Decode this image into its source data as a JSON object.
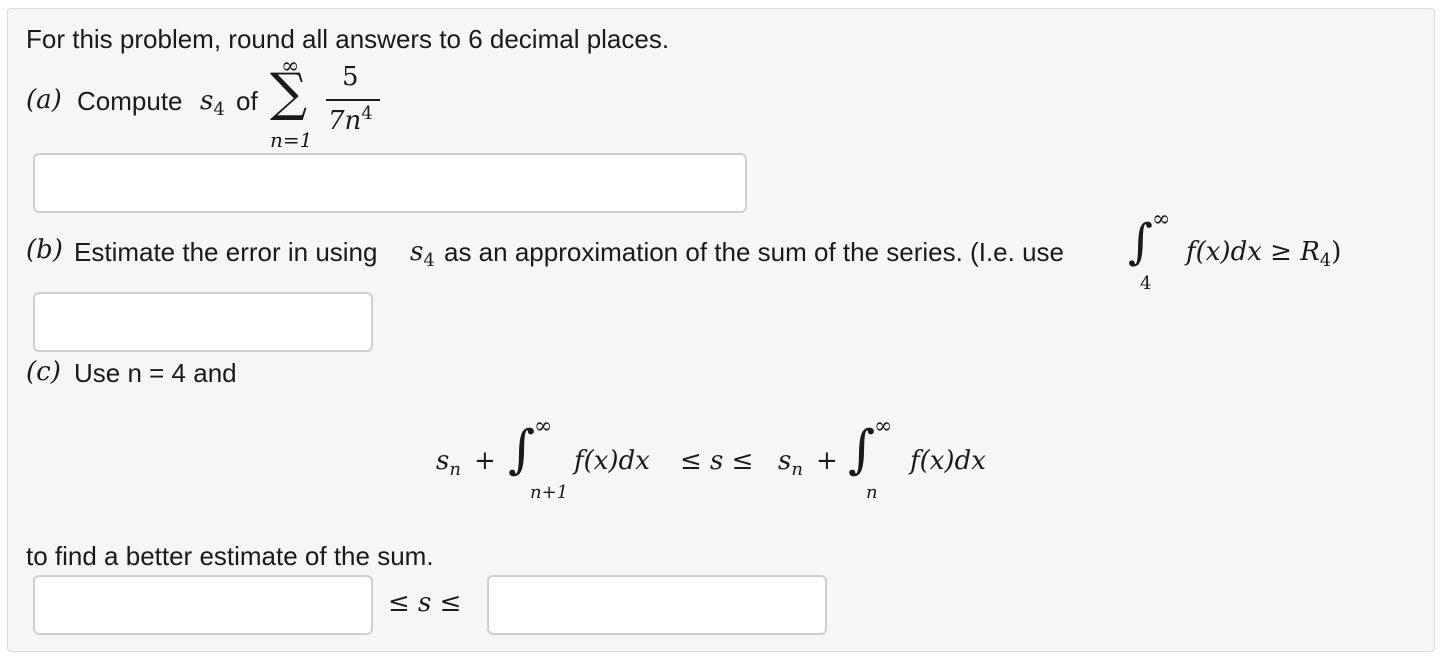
{
  "instructions": "For this problem, round all answers to 6 decimal places.",
  "part_a": {
    "letter": "(a)",
    "text_compute": "Compute",
    "partial_sum": "s",
    "partial_sum_sub": "4",
    "text_of": "of",
    "sum_upper": "∞",
    "sum_lower": "n=1",
    "numerator": "5",
    "denominator": "7n",
    "denominator_power": "4",
    "answer_value": ""
  },
  "part_b": {
    "letter": "(b)",
    "text": "Estimate the error in using",
    "partial_sum": "s",
    "partial_sum_sub": "4",
    "text_after": "as an approximation of the sum of the series. (I.e. use",
    "integral_upper": "∞",
    "integral_lower": "4",
    "integrand": "f(x)dx ≥ R",
    "remainder_sub": "4",
    "close_paren": ")",
    "answer_value": ""
  },
  "part_c": {
    "letter": "(c)",
    "text": "Use n = 4 and",
    "formula": {
      "lhs_sn": "s",
      "lhs_sub": "n",
      "plus": "+",
      "int1_upper": "∞",
      "int1_lower": "n+1",
      "integrand1": "f(x)dx",
      "ineq": "≤ s ≤",
      "rhs_sn": "s",
      "rhs_sub": "n",
      "int2_upper": "∞",
      "int2_lower": "n",
      "integrand2": "f(x)dx"
    },
    "text_after": "to find a better estimate of the sum.",
    "between_text": "≤ s ≤",
    "lower_value": "",
    "upper_value": ""
  }
}
